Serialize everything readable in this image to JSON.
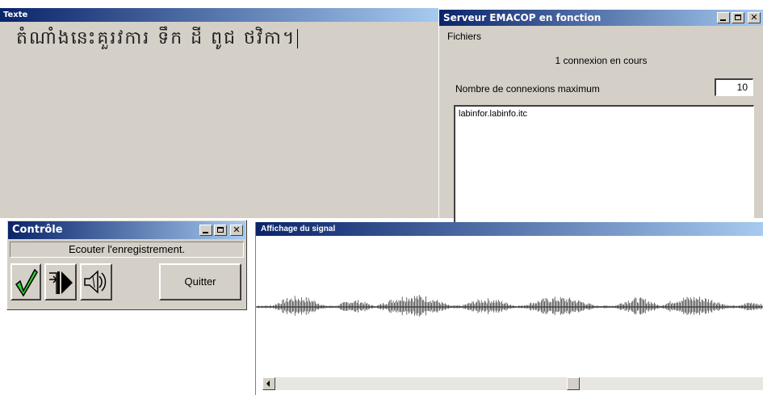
{
  "texte_window": {
    "title": "Texte",
    "content": "តំណាំងនេះគួរវការ ទឹក ដី ពូជ ថវិកា។"
  },
  "server_window": {
    "title": "Serveur EMACOP en fonction",
    "menu_file": "Fichiers",
    "status": "1 connexion en cours",
    "max_label": "Nombre de connexions maximum",
    "max_value": "10",
    "connections": [
      "labinfor.labinfo.itc"
    ]
  },
  "controle_window": {
    "title": "Contrôle",
    "status": "Ecouter l'enregistrement.",
    "quit_label": "Quitter",
    "icons": [
      "validate-check-icon",
      "step-play-icon",
      "speaker-icon"
    ]
  },
  "signal_window": {
    "title": "Affichage du signal"
  },
  "colors": {
    "face": "#d4d0c8",
    "title_start": "#0a246a",
    "title_end": "#a6caf0",
    "check_green": "#33cc33"
  }
}
